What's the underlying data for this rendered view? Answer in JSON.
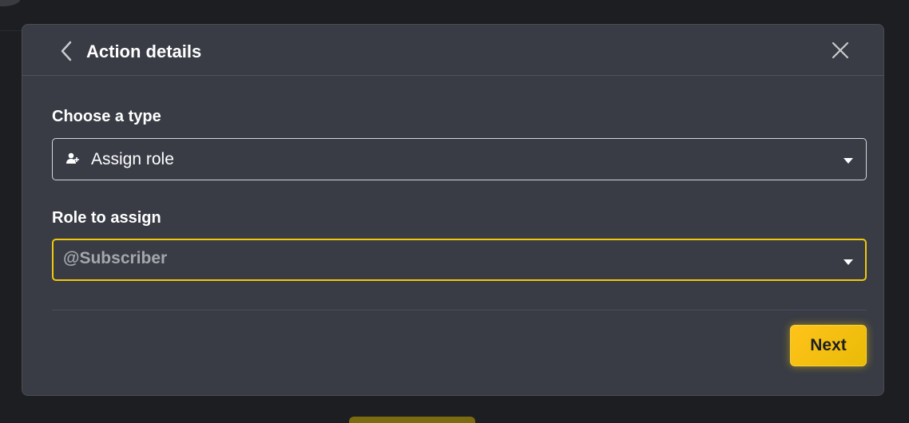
{
  "modal": {
    "title": "Action details",
    "back_icon": "chevron-left-icon",
    "close_icon": "close-icon"
  },
  "type_field": {
    "label": "Choose a type",
    "selected_value": "Assign role",
    "icon": "user-add-icon"
  },
  "role_field": {
    "label": "Role to assign",
    "placeholder": "@Subscriber"
  },
  "footer": {
    "next_label": "Next"
  },
  "colors": {
    "accent": "#f2c80c",
    "modal_bg": "#393c45",
    "page_bg": "#1d1e22"
  }
}
